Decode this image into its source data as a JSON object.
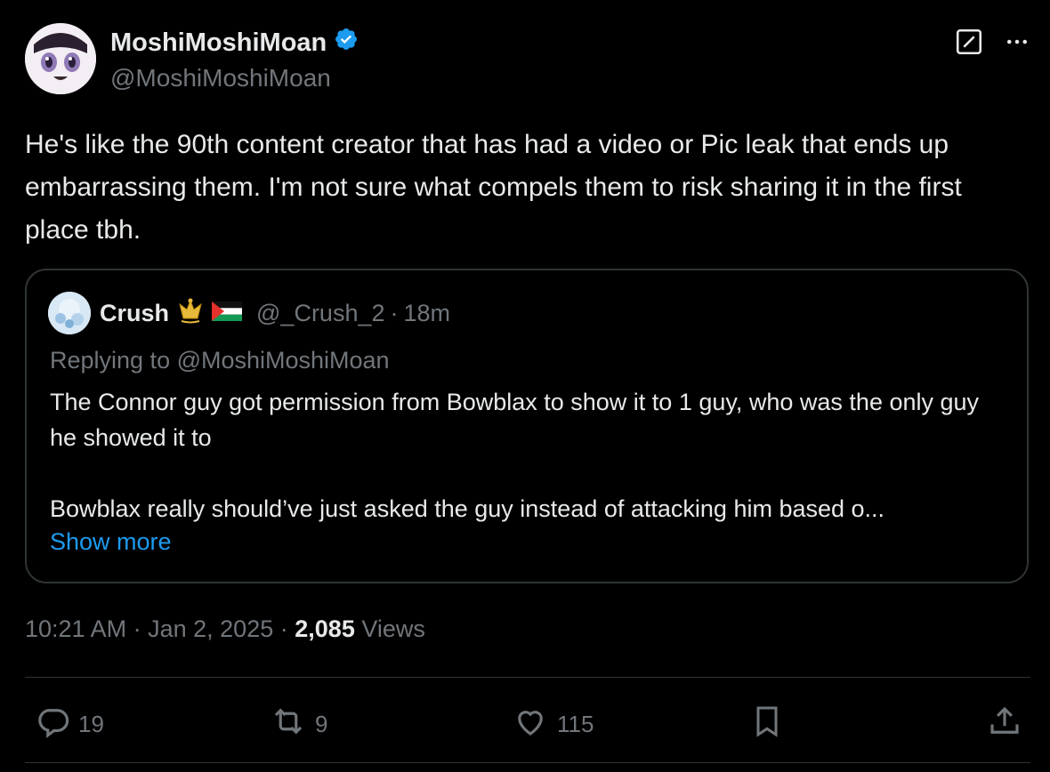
{
  "author": {
    "name": "MoshiMoshiMoan",
    "handle": "@MoshiMoshiMoan",
    "verified": true
  },
  "tweet": {
    "text": "He's like the 90th content creator that has had a video or Pic leak that ends up embarrassing them.  I'm not sure what compels them to risk sharing it in the first place tbh."
  },
  "quote": {
    "name": "Crush",
    "handle": "@_Crush_2",
    "separator": "·",
    "age": "18m",
    "replying_to": "Replying to @MoshiMoshiMoan",
    "text": "The Connor guy got permission from Bowblax to show it to 1 guy, who was the only guy he showed it to\n\nBowblax really should’ve just asked the guy instead of attacking him based o...",
    "show_more": "Show more"
  },
  "meta": {
    "time": "10:21 AM",
    "sep1": "·",
    "date": "Jan 2, 2025",
    "sep2": "·",
    "views_count": "2,085",
    "views_label": "Views"
  },
  "actions": {
    "replies": "19",
    "reposts": "9",
    "likes": "115"
  },
  "colors": {
    "background": "#000000",
    "text": "#e7e9ea",
    "muted": "#71767b",
    "link": "#1d9bf0",
    "verified": "#1d9bf0",
    "border": "#2f3336"
  },
  "icons": [
    "verified-badge-icon",
    "grok-icon",
    "more-icon",
    "reply-icon",
    "repost-icon",
    "like-icon",
    "bookmark-icon",
    "share-icon"
  ]
}
